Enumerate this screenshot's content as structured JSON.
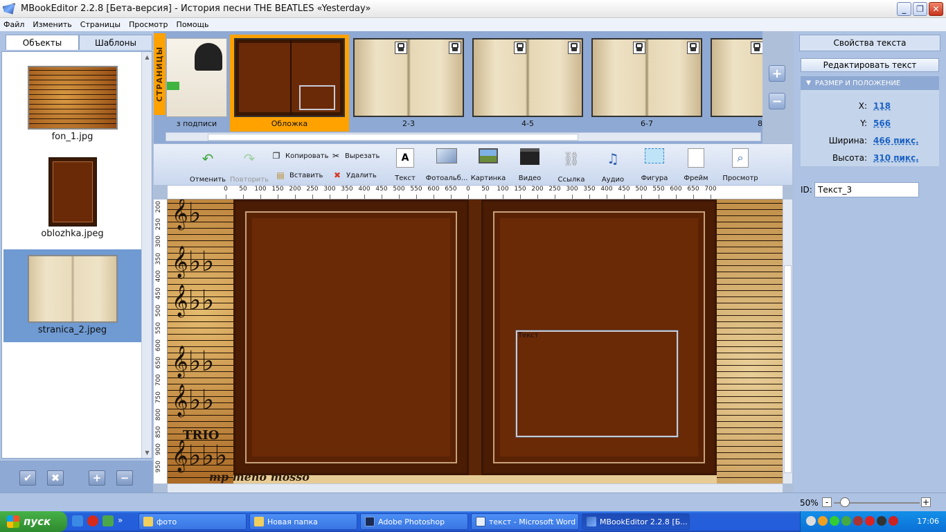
{
  "window": {
    "title": "MBookEditor 2.2.8 [Бета-версия] - История песни THE BEATLES «Yesterday»",
    "minimize": "_",
    "maximize": "❐",
    "close": "✕"
  },
  "menu": [
    "Файл",
    "Изменить",
    "Страницы",
    "Просмотр",
    "Помощь"
  ],
  "left_panel": {
    "tabs": [
      "Объекты",
      "Шаблоны"
    ],
    "active_tab": "Объекты",
    "files": [
      {
        "name": "fon_1.jpg",
        "selected": false
      },
      {
        "name": "oblozhka.jpeg",
        "selected": false
      },
      {
        "name": "stranica_2.jpeg",
        "selected": true
      }
    ],
    "buttons": {
      "confirm": "✔",
      "cancel": "✖",
      "add": "+",
      "remove": "−"
    }
  },
  "pages": {
    "vertical_label": "СТРАНИЦЫ",
    "items": [
      {
        "caption": "з подписи",
        "selected": false,
        "locked": false
      },
      {
        "caption": "Обложка",
        "selected": true,
        "locked": false
      },
      {
        "caption": "2-3",
        "selected": false,
        "locked": true
      },
      {
        "caption": "4-5",
        "selected": false,
        "locked": true
      },
      {
        "caption": "6-7",
        "selected": false,
        "locked": true
      },
      {
        "caption": "8",
        "selected": false,
        "locked": true
      }
    ],
    "zoom_in": "+",
    "zoom_out": "−"
  },
  "toolbar": {
    "undo": "Отменить",
    "redo": "Повторить",
    "copy": "Копировать",
    "cut": "Вырезать",
    "paste": "Вставить",
    "delete": "Удалить",
    "text": "Текст",
    "photoalbum": "Фотоальб...",
    "picture": "Картинка",
    "video": "Видео",
    "link": "Ссылка",
    "audio": "Аудио",
    "shape": "Фигура",
    "frame": "Фрейм",
    "preview": "Просмотр"
  },
  "ruler": {
    "h_ticks": [
      "0",
      "50",
      "100",
      "150",
      "200",
      "250",
      "300",
      "350",
      "400",
      "450",
      "500",
      "550",
      "600",
      "650",
      "0",
      "50",
      "100",
      "150",
      "200",
      "250",
      "300",
      "350",
      "400",
      "450",
      "500",
      "550",
      "600",
      "650",
      "700"
    ],
    "v_ticks": [
      "200",
      "250",
      "300",
      "350",
      "400",
      "450",
      "500",
      "550",
      "600",
      "650",
      "700",
      "750",
      "800",
      "850",
      "900",
      "950"
    ]
  },
  "canvas": {
    "text_box_label": "Текст",
    "sheet_text": "TRIO",
    "bottom_text": "mp meno mosso"
  },
  "right_panel": {
    "tab": "Свойства текста",
    "edit_button": "Редактировать текст",
    "section": "РАЗМЕР И ПОЛОЖЕНИЕ",
    "x_label": "X:",
    "x_value": "118",
    "y_label": "Y:",
    "y_value": "566",
    "width_label": "Ширина:",
    "width_value": "466 пикс.",
    "height_label": "Высота:",
    "height_value": "310 пикс.",
    "id_label": "ID:",
    "id_value": "Текст_3"
  },
  "status": {
    "zoom": "50%",
    "zoom_level": 0.12
  },
  "taskbar": {
    "start": "пуск",
    "tasks": [
      {
        "label": "фото",
        "active": false
      },
      {
        "label": "Новая папка",
        "active": false
      },
      {
        "label": "Adobe Photoshop",
        "active": false
      },
      {
        "label": "текст - Microsoft Word",
        "active": false
      },
      {
        "label": "MBookEditor 2.2.8 [Б...",
        "active": true
      }
    ],
    "clock": "17:06"
  },
  "colors": {
    "accent": "#ffa200",
    "panel": "#aec3e3",
    "cover": "#6b2a06",
    "link_value": "#1c62c4"
  }
}
